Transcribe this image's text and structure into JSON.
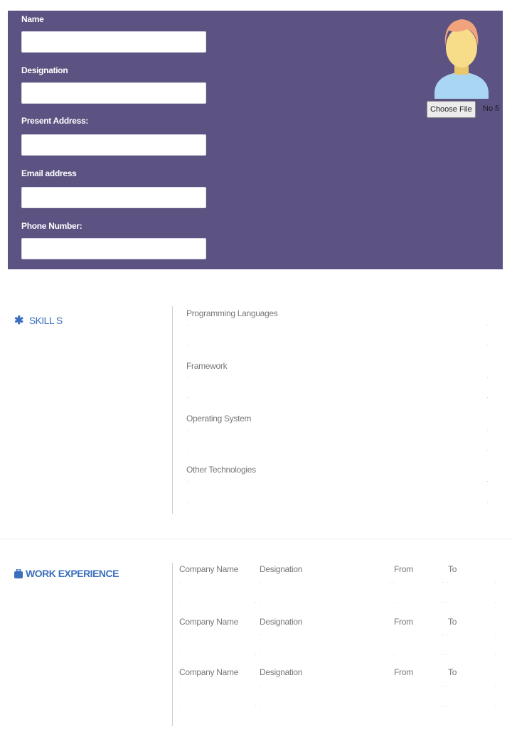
{
  "header": {
    "fields": [
      {
        "label": "Name",
        "value": ""
      },
      {
        "label": "Designation",
        "value": ""
      },
      {
        "label": "Present Address:",
        "value": ""
      },
      {
        "label": "Email address",
        "value": ""
      },
      {
        "label": "Phone Number:",
        "value": ""
      }
    ],
    "choose_file_label": "Choose File",
    "file_status": "No fi"
  },
  "skills": {
    "title": "SKILL S",
    "icon": "asterisk-icon",
    "items": [
      {
        "label": "Programming Languages",
        "value": ""
      },
      {
        "label": "Framework",
        "value": ""
      },
      {
        "label": "Operating System",
        "value": ""
      },
      {
        "label": "Other Technologies",
        "value": ""
      }
    ]
  },
  "work_experience": {
    "title": "WORK EXPERIENCE",
    "icon": "briefcase-icon",
    "columns": [
      "Company Name",
      "Designation",
      "From",
      "To"
    ],
    "rows": [
      {
        "company": "",
        "designation": "",
        "from": "",
        "to": ""
      },
      {
        "company": "",
        "designation": "",
        "from": "",
        "to": ""
      },
      {
        "company": "",
        "designation": "",
        "from": "",
        "to": ""
      }
    ]
  },
  "colors": {
    "header_bg": "#5c5382",
    "accent": "#3a6fbf"
  }
}
